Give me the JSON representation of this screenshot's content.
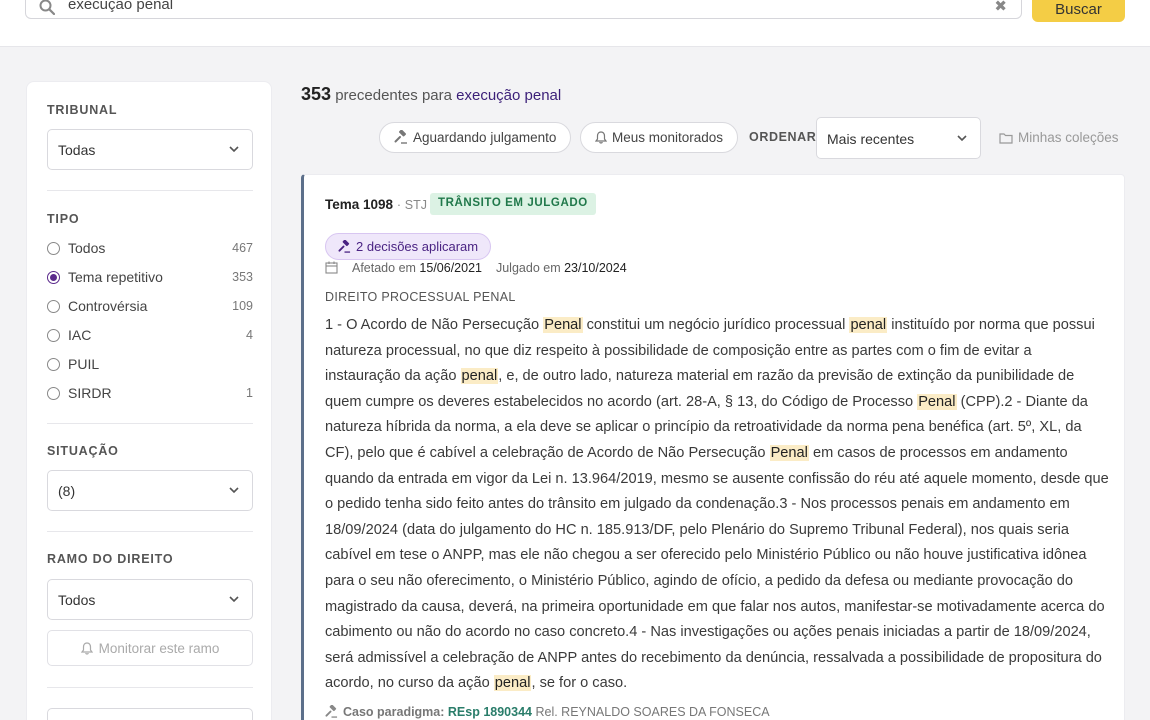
{
  "search": {
    "query": "execução penal",
    "button_label": "Buscar"
  },
  "sidebar": {
    "tribunal": {
      "title": "TRIBUNAL",
      "selected": "Todas"
    },
    "tipo": {
      "title": "TIPO",
      "options": [
        {
          "label": "Todos",
          "count": "467",
          "selected": false
        },
        {
          "label": "Tema repetitivo",
          "count": "353",
          "selected": true
        },
        {
          "label": "Controvérsia",
          "count": "109",
          "selected": false
        },
        {
          "label": "IAC",
          "count": "4",
          "selected": false
        },
        {
          "label": "PUIL",
          "count": "",
          "selected": false
        },
        {
          "label": "SIRDR",
          "count": "1",
          "selected": false
        }
      ]
    },
    "situacao": {
      "title": "SITUAÇÃO",
      "selected": "(8)"
    },
    "ramo": {
      "title": "RAMO DO DIREITO",
      "selected": "Todos",
      "monitor_label": "Monitorar este ramo"
    }
  },
  "results": {
    "count": "353",
    "label": "precedentes para",
    "query": "execução penal"
  },
  "toolbar": {
    "awaiting_label": "Aguardando julgamento",
    "monitored_label": "Meus monitorados",
    "order_label": "ORDENAR",
    "order_selected": "Mais recentes",
    "collections_label": "Minhas coleções"
  },
  "card": {
    "tema": "Tema 1098",
    "separator": "·",
    "court": "STJ",
    "status_badge": "TRÂNSITO EM JULGADO",
    "decisions_badge": "2 decisões aplicaram",
    "afetado_label": "Afetado em",
    "afetado_date": "15/06/2021",
    "julgado_label": "Julgado em",
    "julgado_date": "23/10/2024",
    "area": "DIREITO PROCESSUAL PENAL",
    "ementa_segments": [
      {
        "t": "1 - O Acordo de Não Persecução ",
        "h": false
      },
      {
        "t": "Penal",
        "h": true
      },
      {
        "t": " constitui um negócio jurídico processual ",
        "h": false
      },
      {
        "t": "penal",
        "h": true
      },
      {
        "t": " instituído por norma que possui natureza processual, no que diz respeito à possibilidade de composição entre as partes com o fim de evitar a instauração da ação ",
        "h": false
      },
      {
        "t": "penal",
        "h": true
      },
      {
        "t": ", e, de outro lado, natureza material em razão da previsão de extinção da punibilidade de quem cumpre os deveres estabelecidos no acordo (art. 28-A, § 13, do Código de Processo ",
        "h": false
      },
      {
        "t": "Penal",
        "h": true
      },
      {
        "t": " (CPP).2 - Diante da natureza híbrida da norma, a ela deve se aplicar o princípio da retroatividade da norma pena benéfica (art. 5º, XL, da CF), pelo que é cabível a celebração de Acordo de Não Persecução ",
        "h": false
      },
      {
        "t": "Penal",
        "h": true
      },
      {
        "t": " em casos de processos em andamento quando da entrada em vigor da Lei n. 13.964/2019, mesmo se ausente confissão do réu até aquele momento, desde que o pedido tenha sido feito antes do trânsito em julgado da condenação.3 - Nos processos penais em andamento em 18/09/2024 (data do julgamento do HC n. 185.913/DF, pelo Plenário do Supremo Tribunal Federal), nos quais seria cabível em tese o ANPP, mas ele não chegou a ser oferecido pelo Ministério Público ou não houve justificativa idônea para o seu não oferecimento, o Ministério Público, agindo de ofício, a pedido da defesa ou mediante provocação do magistrado da causa, deverá, na primeira oportunidade em que falar nos autos, manifestar-se motivadamente acerca do cabimento ou não do acordo no caso concreto.4 - Nas investigações ou ações penais iniciadas a partir de 18/09/2024, será admissível a celebração de ANPP antes do recebimento da denúncia, ressalvada a possibilidade de propositura do acordo, no curso da ação ",
        "h": false
      },
      {
        "t": "penal",
        "h": true
      },
      {
        "t": ", se for o caso.",
        "h": false
      }
    ],
    "paradigma_label": "Caso paradigma:",
    "paradigma_ref": "REsp 1890344",
    "relator": "Rel. REYNALDO SOARES DA FONSECA"
  },
  "colors": {
    "accent_purple": "#5b2a8c",
    "button_yellow": "#f4cd45",
    "highlight": "#fbecc6",
    "status_green": "#20784a"
  },
  "icons": {
    "search": "search-icon",
    "clear": "close-icon",
    "chevron": "chevron-down-icon",
    "gavel": "gavel-icon",
    "bell": "bell-icon",
    "folder": "folder-icon",
    "calendar": "calendar-icon"
  }
}
